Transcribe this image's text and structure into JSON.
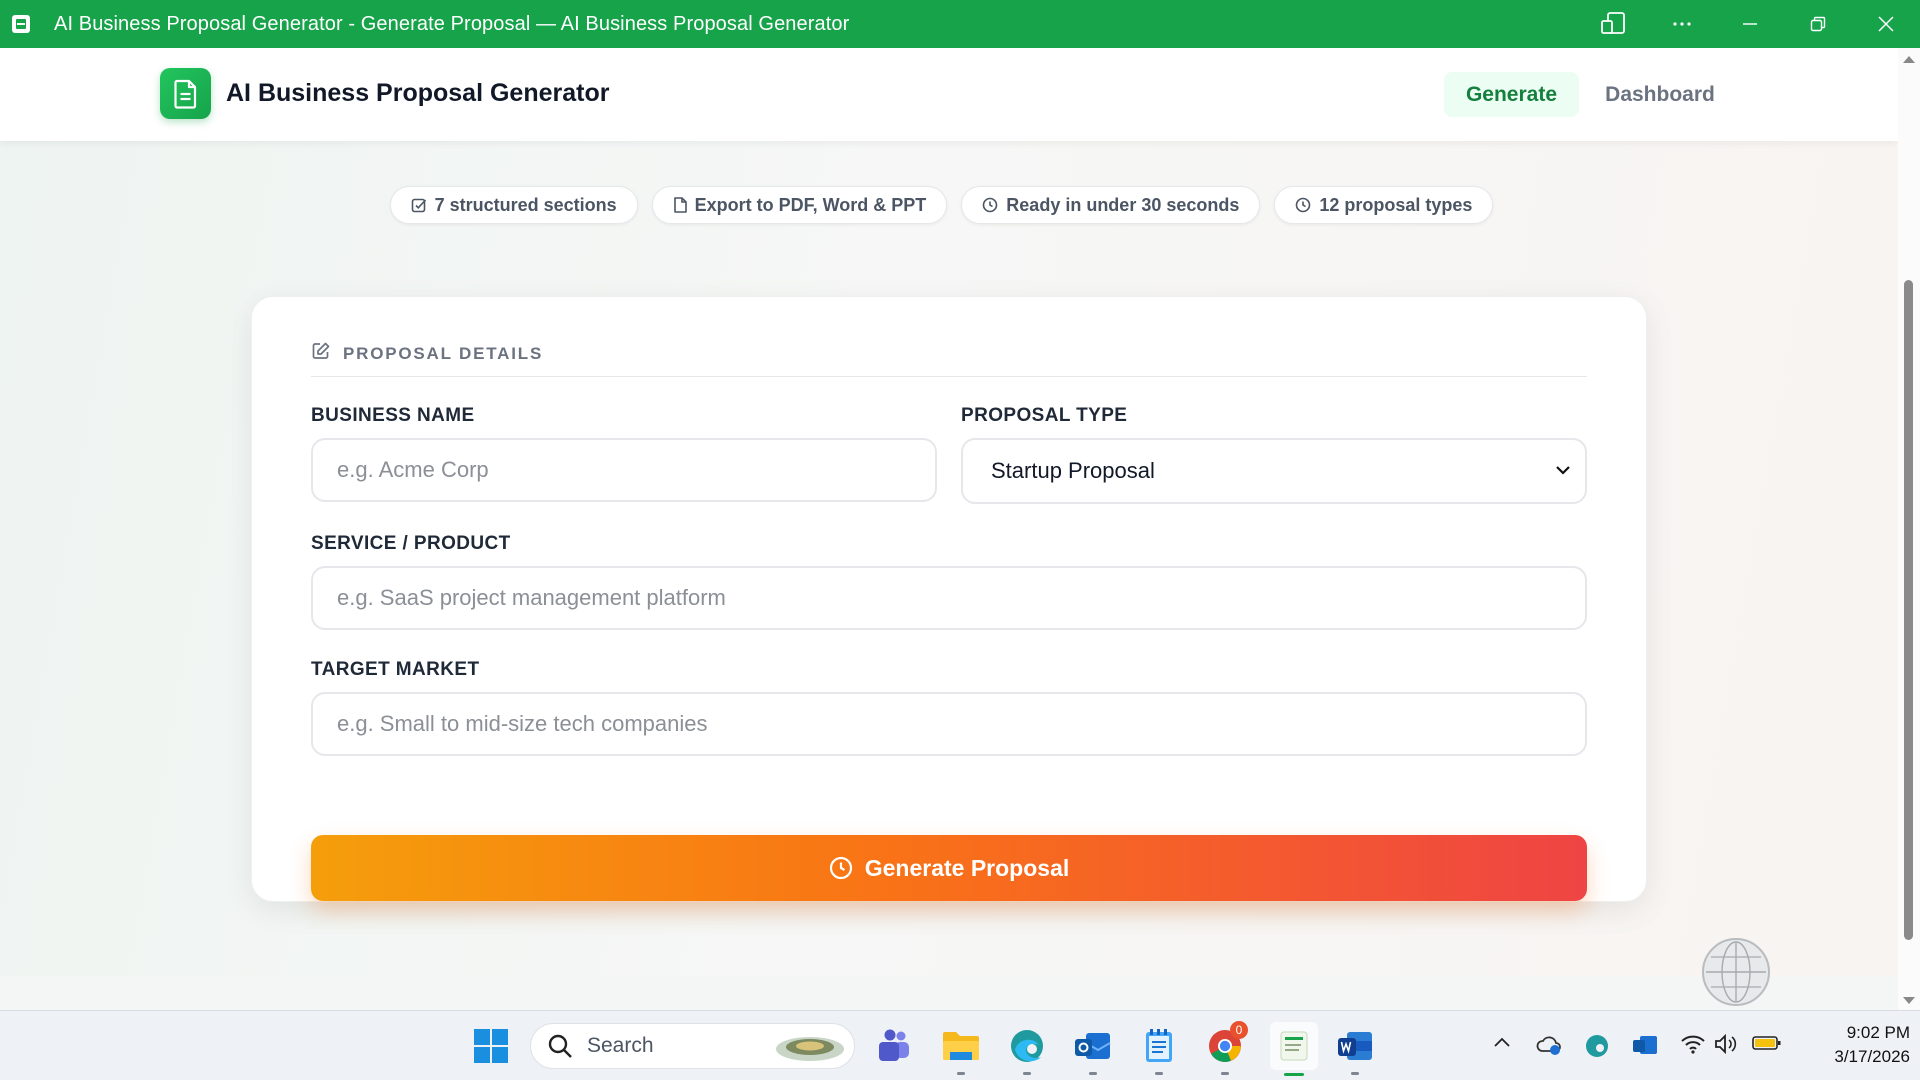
{
  "window": {
    "title": "AI Business Proposal Generator - Generate Proposal — AI Business Proposal Generator"
  },
  "header": {
    "brand": "AI Business Proposal Generator",
    "nav": {
      "generate": "Generate",
      "dashboard": "Dashboard"
    }
  },
  "features": [
    {
      "label": "7 structured sections",
      "icon": "checkbox-icon"
    },
    {
      "label": "Export to PDF, Word & PPT",
      "icon": "document-icon"
    },
    {
      "label": "Ready in under 30 seconds",
      "icon": "clock-icon"
    },
    {
      "label": "12 proposal types",
      "icon": "clock-icon"
    }
  ],
  "form": {
    "section_title": "PROPOSAL DETAILS",
    "business_name": {
      "label": "BUSINESS NAME",
      "placeholder": "e.g. Acme Corp",
      "value": ""
    },
    "proposal_type": {
      "label": "PROPOSAL TYPE",
      "value": "Startup Proposal"
    },
    "service": {
      "label": "SERVICE / PRODUCT",
      "placeholder": "e.g. SaaS project management platform",
      "value": ""
    },
    "target_market": {
      "label": "TARGET MARKET",
      "placeholder": "e.g. Small to mid-size tech companies",
      "value": ""
    },
    "submit_label": "Generate Proposal"
  },
  "taskbar": {
    "search_placeholder": "Search",
    "chrome_badge": "0",
    "time": "9:02 PM",
    "date": "3/17/2026"
  },
  "colors": {
    "title_bar": "#16a34a",
    "brand_accent": "#22c55e",
    "button_gradient_start": "#f59e0b",
    "button_gradient_end": "#ef4444"
  }
}
